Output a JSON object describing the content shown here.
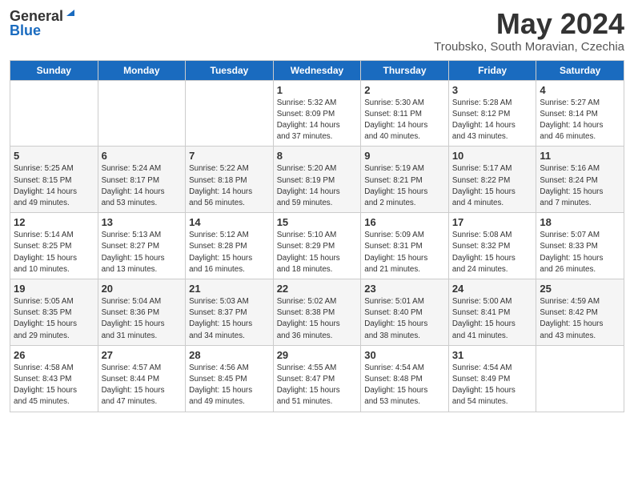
{
  "header": {
    "logo_general": "General",
    "logo_blue": "Blue",
    "month_title": "May 2024",
    "location": "Troubsko, South Moravian, Czechia"
  },
  "weekdays": [
    "Sunday",
    "Monday",
    "Tuesday",
    "Wednesday",
    "Thursday",
    "Friday",
    "Saturday"
  ],
  "weeks": [
    [
      {
        "day": "",
        "info": ""
      },
      {
        "day": "",
        "info": ""
      },
      {
        "day": "",
        "info": ""
      },
      {
        "day": "1",
        "info": "Sunrise: 5:32 AM\nSunset: 8:09 PM\nDaylight: 14 hours\nand 37 minutes."
      },
      {
        "day": "2",
        "info": "Sunrise: 5:30 AM\nSunset: 8:11 PM\nDaylight: 14 hours\nand 40 minutes."
      },
      {
        "day": "3",
        "info": "Sunrise: 5:28 AM\nSunset: 8:12 PM\nDaylight: 14 hours\nand 43 minutes."
      },
      {
        "day": "4",
        "info": "Sunrise: 5:27 AM\nSunset: 8:14 PM\nDaylight: 14 hours\nand 46 minutes."
      }
    ],
    [
      {
        "day": "5",
        "info": "Sunrise: 5:25 AM\nSunset: 8:15 PM\nDaylight: 14 hours\nand 49 minutes."
      },
      {
        "day": "6",
        "info": "Sunrise: 5:24 AM\nSunset: 8:17 PM\nDaylight: 14 hours\nand 53 minutes."
      },
      {
        "day": "7",
        "info": "Sunrise: 5:22 AM\nSunset: 8:18 PM\nDaylight: 14 hours\nand 56 minutes."
      },
      {
        "day": "8",
        "info": "Sunrise: 5:20 AM\nSunset: 8:19 PM\nDaylight: 14 hours\nand 59 minutes."
      },
      {
        "day": "9",
        "info": "Sunrise: 5:19 AM\nSunset: 8:21 PM\nDaylight: 15 hours\nand 2 minutes."
      },
      {
        "day": "10",
        "info": "Sunrise: 5:17 AM\nSunset: 8:22 PM\nDaylight: 15 hours\nand 4 minutes."
      },
      {
        "day": "11",
        "info": "Sunrise: 5:16 AM\nSunset: 8:24 PM\nDaylight: 15 hours\nand 7 minutes."
      }
    ],
    [
      {
        "day": "12",
        "info": "Sunrise: 5:14 AM\nSunset: 8:25 PM\nDaylight: 15 hours\nand 10 minutes."
      },
      {
        "day": "13",
        "info": "Sunrise: 5:13 AM\nSunset: 8:27 PM\nDaylight: 15 hours\nand 13 minutes."
      },
      {
        "day": "14",
        "info": "Sunrise: 5:12 AM\nSunset: 8:28 PM\nDaylight: 15 hours\nand 16 minutes."
      },
      {
        "day": "15",
        "info": "Sunrise: 5:10 AM\nSunset: 8:29 PM\nDaylight: 15 hours\nand 18 minutes."
      },
      {
        "day": "16",
        "info": "Sunrise: 5:09 AM\nSunset: 8:31 PM\nDaylight: 15 hours\nand 21 minutes."
      },
      {
        "day": "17",
        "info": "Sunrise: 5:08 AM\nSunset: 8:32 PM\nDaylight: 15 hours\nand 24 minutes."
      },
      {
        "day": "18",
        "info": "Sunrise: 5:07 AM\nSunset: 8:33 PM\nDaylight: 15 hours\nand 26 minutes."
      }
    ],
    [
      {
        "day": "19",
        "info": "Sunrise: 5:05 AM\nSunset: 8:35 PM\nDaylight: 15 hours\nand 29 minutes."
      },
      {
        "day": "20",
        "info": "Sunrise: 5:04 AM\nSunset: 8:36 PM\nDaylight: 15 hours\nand 31 minutes."
      },
      {
        "day": "21",
        "info": "Sunrise: 5:03 AM\nSunset: 8:37 PM\nDaylight: 15 hours\nand 34 minutes."
      },
      {
        "day": "22",
        "info": "Sunrise: 5:02 AM\nSunset: 8:38 PM\nDaylight: 15 hours\nand 36 minutes."
      },
      {
        "day": "23",
        "info": "Sunrise: 5:01 AM\nSunset: 8:40 PM\nDaylight: 15 hours\nand 38 minutes."
      },
      {
        "day": "24",
        "info": "Sunrise: 5:00 AM\nSunset: 8:41 PM\nDaylight: 15 hours\nand 41 minutes."
      },
      {
        "day": "25",
        "info": "Sunrise: 4:59 AM\nSunset: 8:42 PM\nDaylight: 15 hours\nand 43 minutes."
      }
    ],
    [
      {
        "day": "26",
        "info": "Sunrise: 4:58 AM\nSunset: 8:43 PM\nDaylight: 15 hours\nand 45 minutes."
      },
      {
        "day": "27",
        "info": "Sunrise: 4:57 AM\nSunset: 8:44 PM\nDaylight: 15 hours\nand 47 minutes."
      },
      {
        "day": "28",
        "info": "Sunrise: 4:56 AM\nSunset: 8:45 PM\nDaylight: 15 hours\nand 49 minutes."
      },
      {
        "day": "29",
        "info": "Sunrise: 4:55 AM\nSunset: 8:47 PM\nDaylight: 15 hours\nand 51 minutes."
      },
      {
        "day": "30",
        "info": "Sunrise: 4:54 AM\nSunset: 8:48 PM\nDaylight: 15 hours\nand 53 minutes."
      },
      {
        "day": "31",
        "info": "Sunrise: 4:54 AM\nSunset: 8:49 PM\nDaylight: 15 hours\nand 54 minutes."
      },
      {
        "day": "",
        "info": ""
      }
    ]
  ]
}
